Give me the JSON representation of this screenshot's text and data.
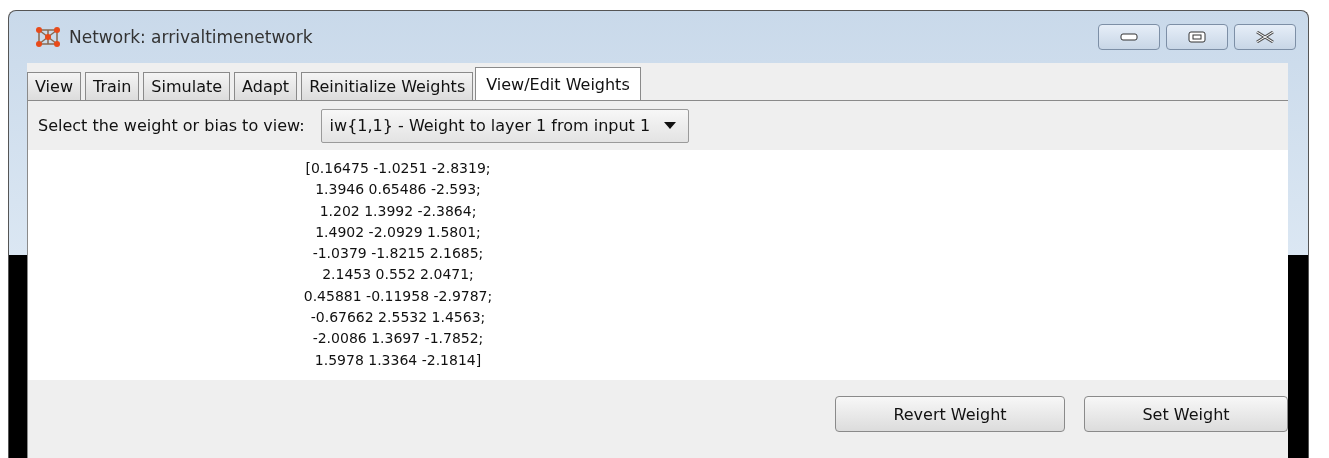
{
  "window": {
    "title": "Network: arrivaltimenetwork"
  },
  "tabs": [
    {
      "label": "View",
      "selected": false
    },
    {
      "label": "Train",
      "selected": false
    },
    {
      "label": "Simulate",
      "selected": false
    },
    {
      "label": "Adapt",
      "selected": false
    },
    {
      "label": "Reinitialize Weights",
      "selected": false
    },
    {
      "label": "View/Edit Weights",
      "selected": true
    }
  ],
  "selector": {
    "label": "Select the weight or bias to view:",
    "value": "iw{1,1} - Weight to layer 1 from input 1"
  },
  "matrix_lines": [
    "[0.16475 -1.0251 -2.8319;",
    "1.3946 0.65486 -2.593;",
    "1.202 1.3992 -2.3864;",
    "1.4902 -2.0929 1.5801;",
    "-1.0379 -1.8215 2.1685;",
    "2.1453 0.552 2.0471;",
    "0.45881 -0.11958 -2.9787;",
    "-0.67662 2.5532 1.4563;",
    "-2.0086 1.3697 -1.7852;",
    "1.5978 1.3364 -2.1814]"
  ],
  "buttons": [
    "Revert Weight",
    "Set Weight"
  ]
}
